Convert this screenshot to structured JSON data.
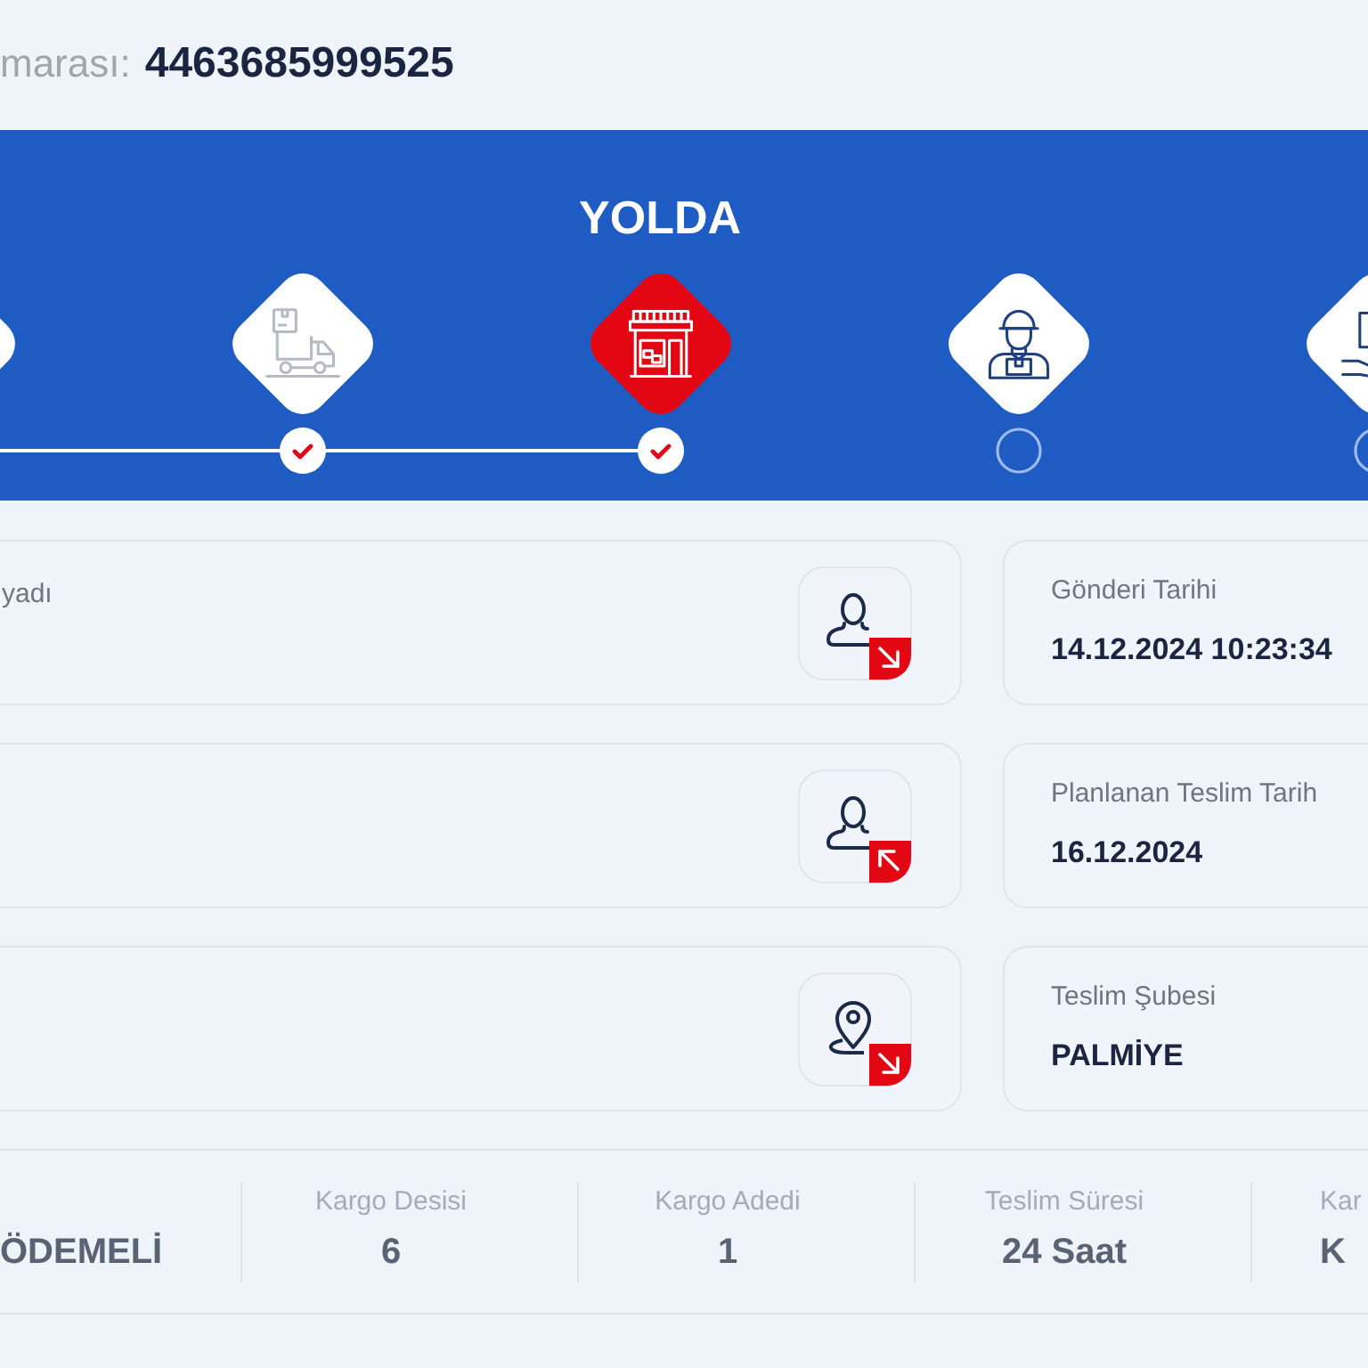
{
  "tracking": {
    "label": "marası:",
    "number": "4463685999525"
  },
  "status_banner": {
    "title": "YOLDA",
    "steps": [
      {
        "selected": false
      },
      {
        "checked": true,
        "selected": false
      },
      {
        "checked": true,
        "selected": true
      },
      {
        "checked": false,
        "selected": false
      },
      {
        "checked": false,
        "selected": false
      }
    ]
  },
  "left_cards": [
    {
      "label": "yadı"
    }
  ],
  "detail_cards": [
    {
      "label": "Gönderi Tarihi",
      "value": "14.12.2024 10:23:34"
    },
    {
      "label": "Planlanan Teslim Tarih",
      "value": "16.12.2024"
    },
    {
      "label": "Teslim Şubesi",
      "value": "PALMİYE"
    }
  ],
  "summary": [
    {
      "value": "ÖDEMELİ"
    },
    {
      "label": "Kargo Desisi",
      "value": "6"
    },
    {
      "label": "Kargo Adedi",
      "value": "1"
    },
    {
      "label": "Teslim Süresi",
      "value": "24 Saat"
    },
    {
      "label": "Kar",
      "value": "K"
    }
  ]
}
